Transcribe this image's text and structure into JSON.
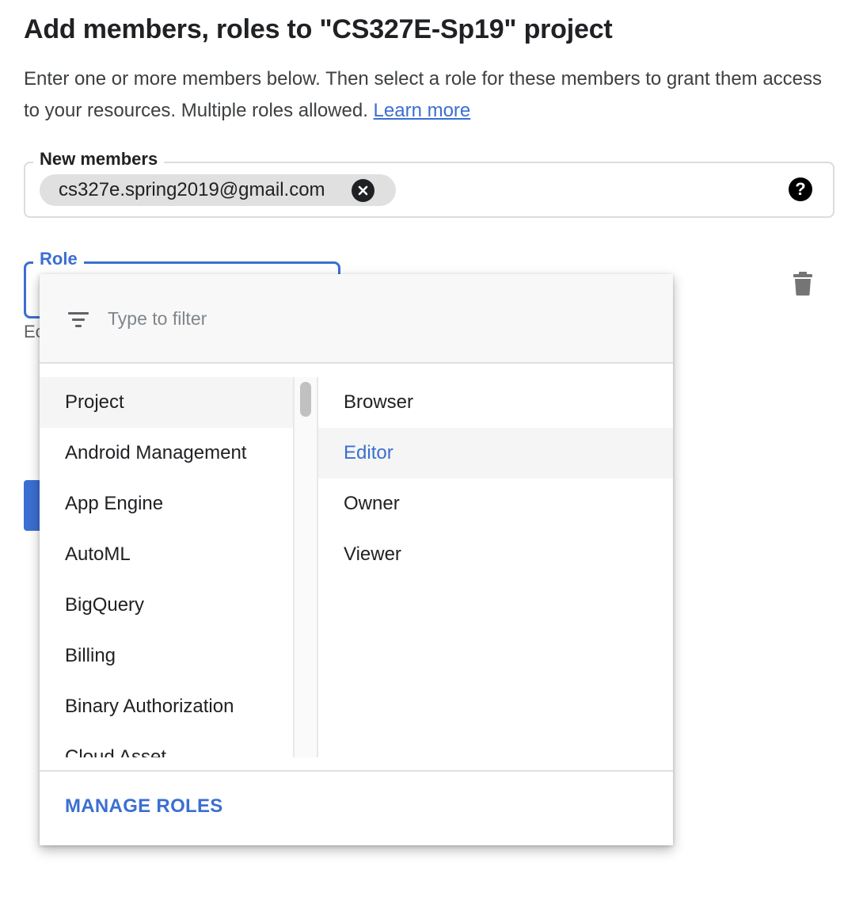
{
  "header": {
    "title": "Add members, roles to \"CS327E-Sp19\" project",
    "description": "Enter one or more members below. Then select a role for these members to grant them access to your resources. Multiple roles allowed.",
    "learn_more": "Learn more"
  },
  "members": {
    "label": "New members",
    "chips": [
      "cs327e.spring2019@gmail.com"
    ],
    "chip_remove_icon": "close-circle-icon",
    "help_icon": "help-circle-icon",
    "help_glyph": "?"
  },
  "role": {
    "label": "Role",
    "hint_fragment": "Ec",
    "delete_icon": "trash-icon"
  },
  "dropdown": {
    "filter_icon": "filter-icon",
    "filter_placeholder": "Type to filter",
    "services": [
      "Project",
      "Android Management",
      "App Engine",
      "AutoML",
      "BigQuery",
      "Billing",
      "Binary Authorization",
      "Cloud Asset"
    ],
    "selected_service": "Project",
    "roles": [
      "Browser",
      "Editor",
      "Owner",
      "Viewer"
    ],
    "highlighted_role": "Editor",
    "manage_roles": "MANAGE ROLES"
  },
  "colors": {
    "accent": "#3b6fd1",
    "text": "#202124",
    "chip_bg": "#e0e0e0",
    "row_highlight": "#f5f5f5"
  }
}
